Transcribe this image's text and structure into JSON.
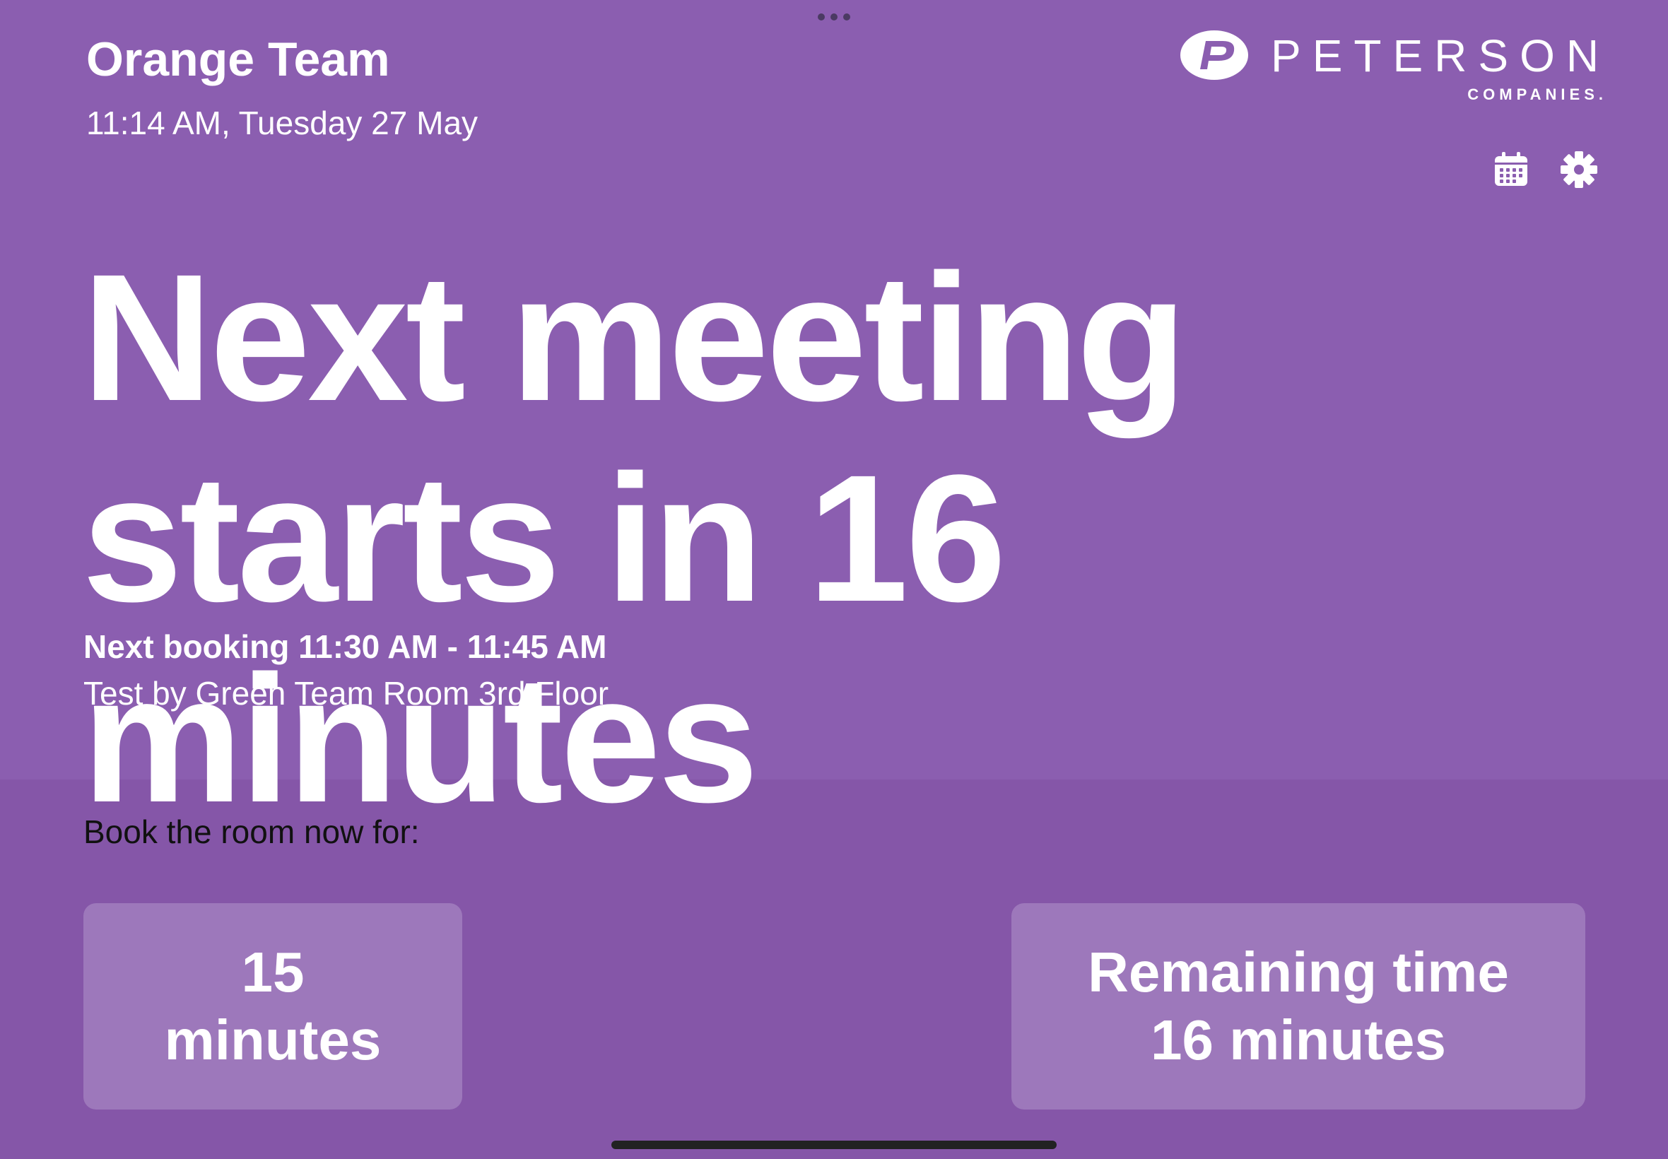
{
  "room": {
    "name": "Orange Team",
    "datetime": "11:14 AM, Tuesday 27 May"
  },
  "logo": {
    "wordmark": "PETERSON",
    "subtext": "COMPANIES."
  },
  "toolbar": {
    "calendar_icon": "calendar-icon",
    "settings_icon": "gear-icon"
  },
  "status": {
    "headline": "Next meeting starts in 16 minutes",
    "next_booking": "Next booking 11:30 AM - 11:45 AM",
    "booking_detail": "Test by Green Team Room 3rd Floor"
  },
  "booking": {
    "prompt": "Book the room now for:",
    "options": [
      {
        "line1": "15",
        "line2": "minutes"
      },
      {
        "line1": "Remaining time",
        "line2": "16 minutes"
      }
    ]
  },
  "colors": {
    "background_top": "#8b5eb0",
    "background_bottom": "#8556a8",
    "button": "#9d78bb",
    "text": "#ffffff"
  }
}
